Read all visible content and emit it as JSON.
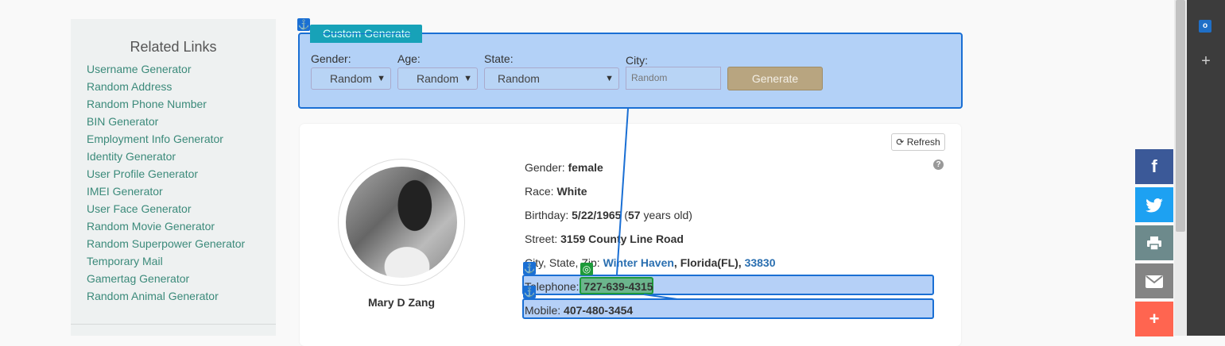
{
  "sidebar": {
    "title": "Related Links",
    "items": [
      "Username Generator",
      "Random Address",
      "Random Phone Number",
      "BIN Generator",
      "Employment Info Generator",
      "Identity Generator",
      "User Profile Generator",
      "IMEI Generator",
      "User Face Generator",
      "Random Movie Generator",
      "Random Superpower Generator",
      "Temporary Mail",
      "Gamertag Generator",
      "Random Animal Generator"
    ]
  },
  "generator": {
    "tab_label": "Custom Generate",
    "gender_label": "Gender:",
    "gender_value": "Random",
    "age_label": "Age:",
    "age_value": "Random",
    "state_label": "State:",
    "state_value": "Random",
    "city_label": "City:",
    "city_placeholder": "Random",
    "generate_label": "Generate"
  },
  "profile": {
    "refresh_label": "Refresh",
    "name": "Mary D Zang",
    "gender_label": "Gender:",
    "gender": "female",
    "race_label": "Race:",
    "race": "White",
    "birthday_label": "Birthday:",
    "birthday": "5/22/1965",
    "age_open": "(",
    "age": "57",
    "age_suffix": "years old)",
    "street_label": "Street:",
    "street": "3159 County Line Road",
    "csz_label": "City, State, Zip:",
    "city": "Winter Haven",
    "state": "Florida(FL)",
    "zip": "33830",
    "telephone_label": "Telephone:",
    "telephone": "727-639-4315",
    "mobile_label": "Mobile:",
    "mobile": "407-480-3454"
  },
  "share_bar": [
    {
      "name": "facebook",
      "color": "#3b5998"
    },
    {
      "name": "twitter",
      "color": "#1da1f2"
    },
    {
      "name": "print",
      "color": "#6d8a8c"
    },
    {
      "name": "email",
      "color": "#848484"
    },
    {
      "name": "more",
      "color": "#ff6550"
    }
  ],
  "colors": {
    "accent": "#17a2b8",
    "link": "#3b8a7a",
    "highlight_border": "#1a6fd4",
    "target_green": "#1d9a3a"
  }
}
